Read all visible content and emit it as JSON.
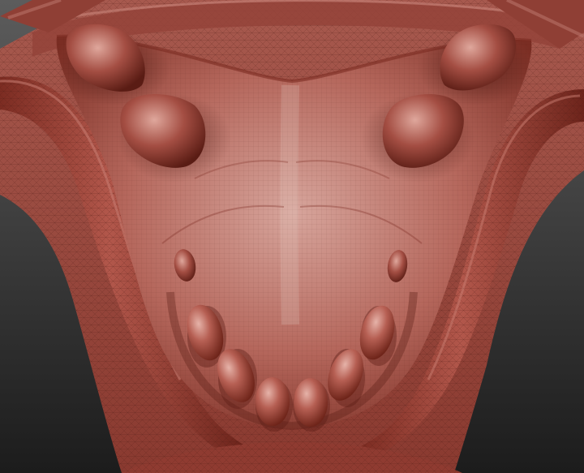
{
  "scene": {
    "subject": "clay-sculpt-palate-mesh",
    "colors": {
      "background_top": "#5c5c5c",
      "background_bottom": "#1c1c1c",
      "clay_light": "#c07b72",
      "clay_mid": "#a44e43",
      "clay_dark": "#5a1c14",
      "clay_highlight": "#e3b2a8",
      "wireframe": "#4a1a12"
    }
  }
}
